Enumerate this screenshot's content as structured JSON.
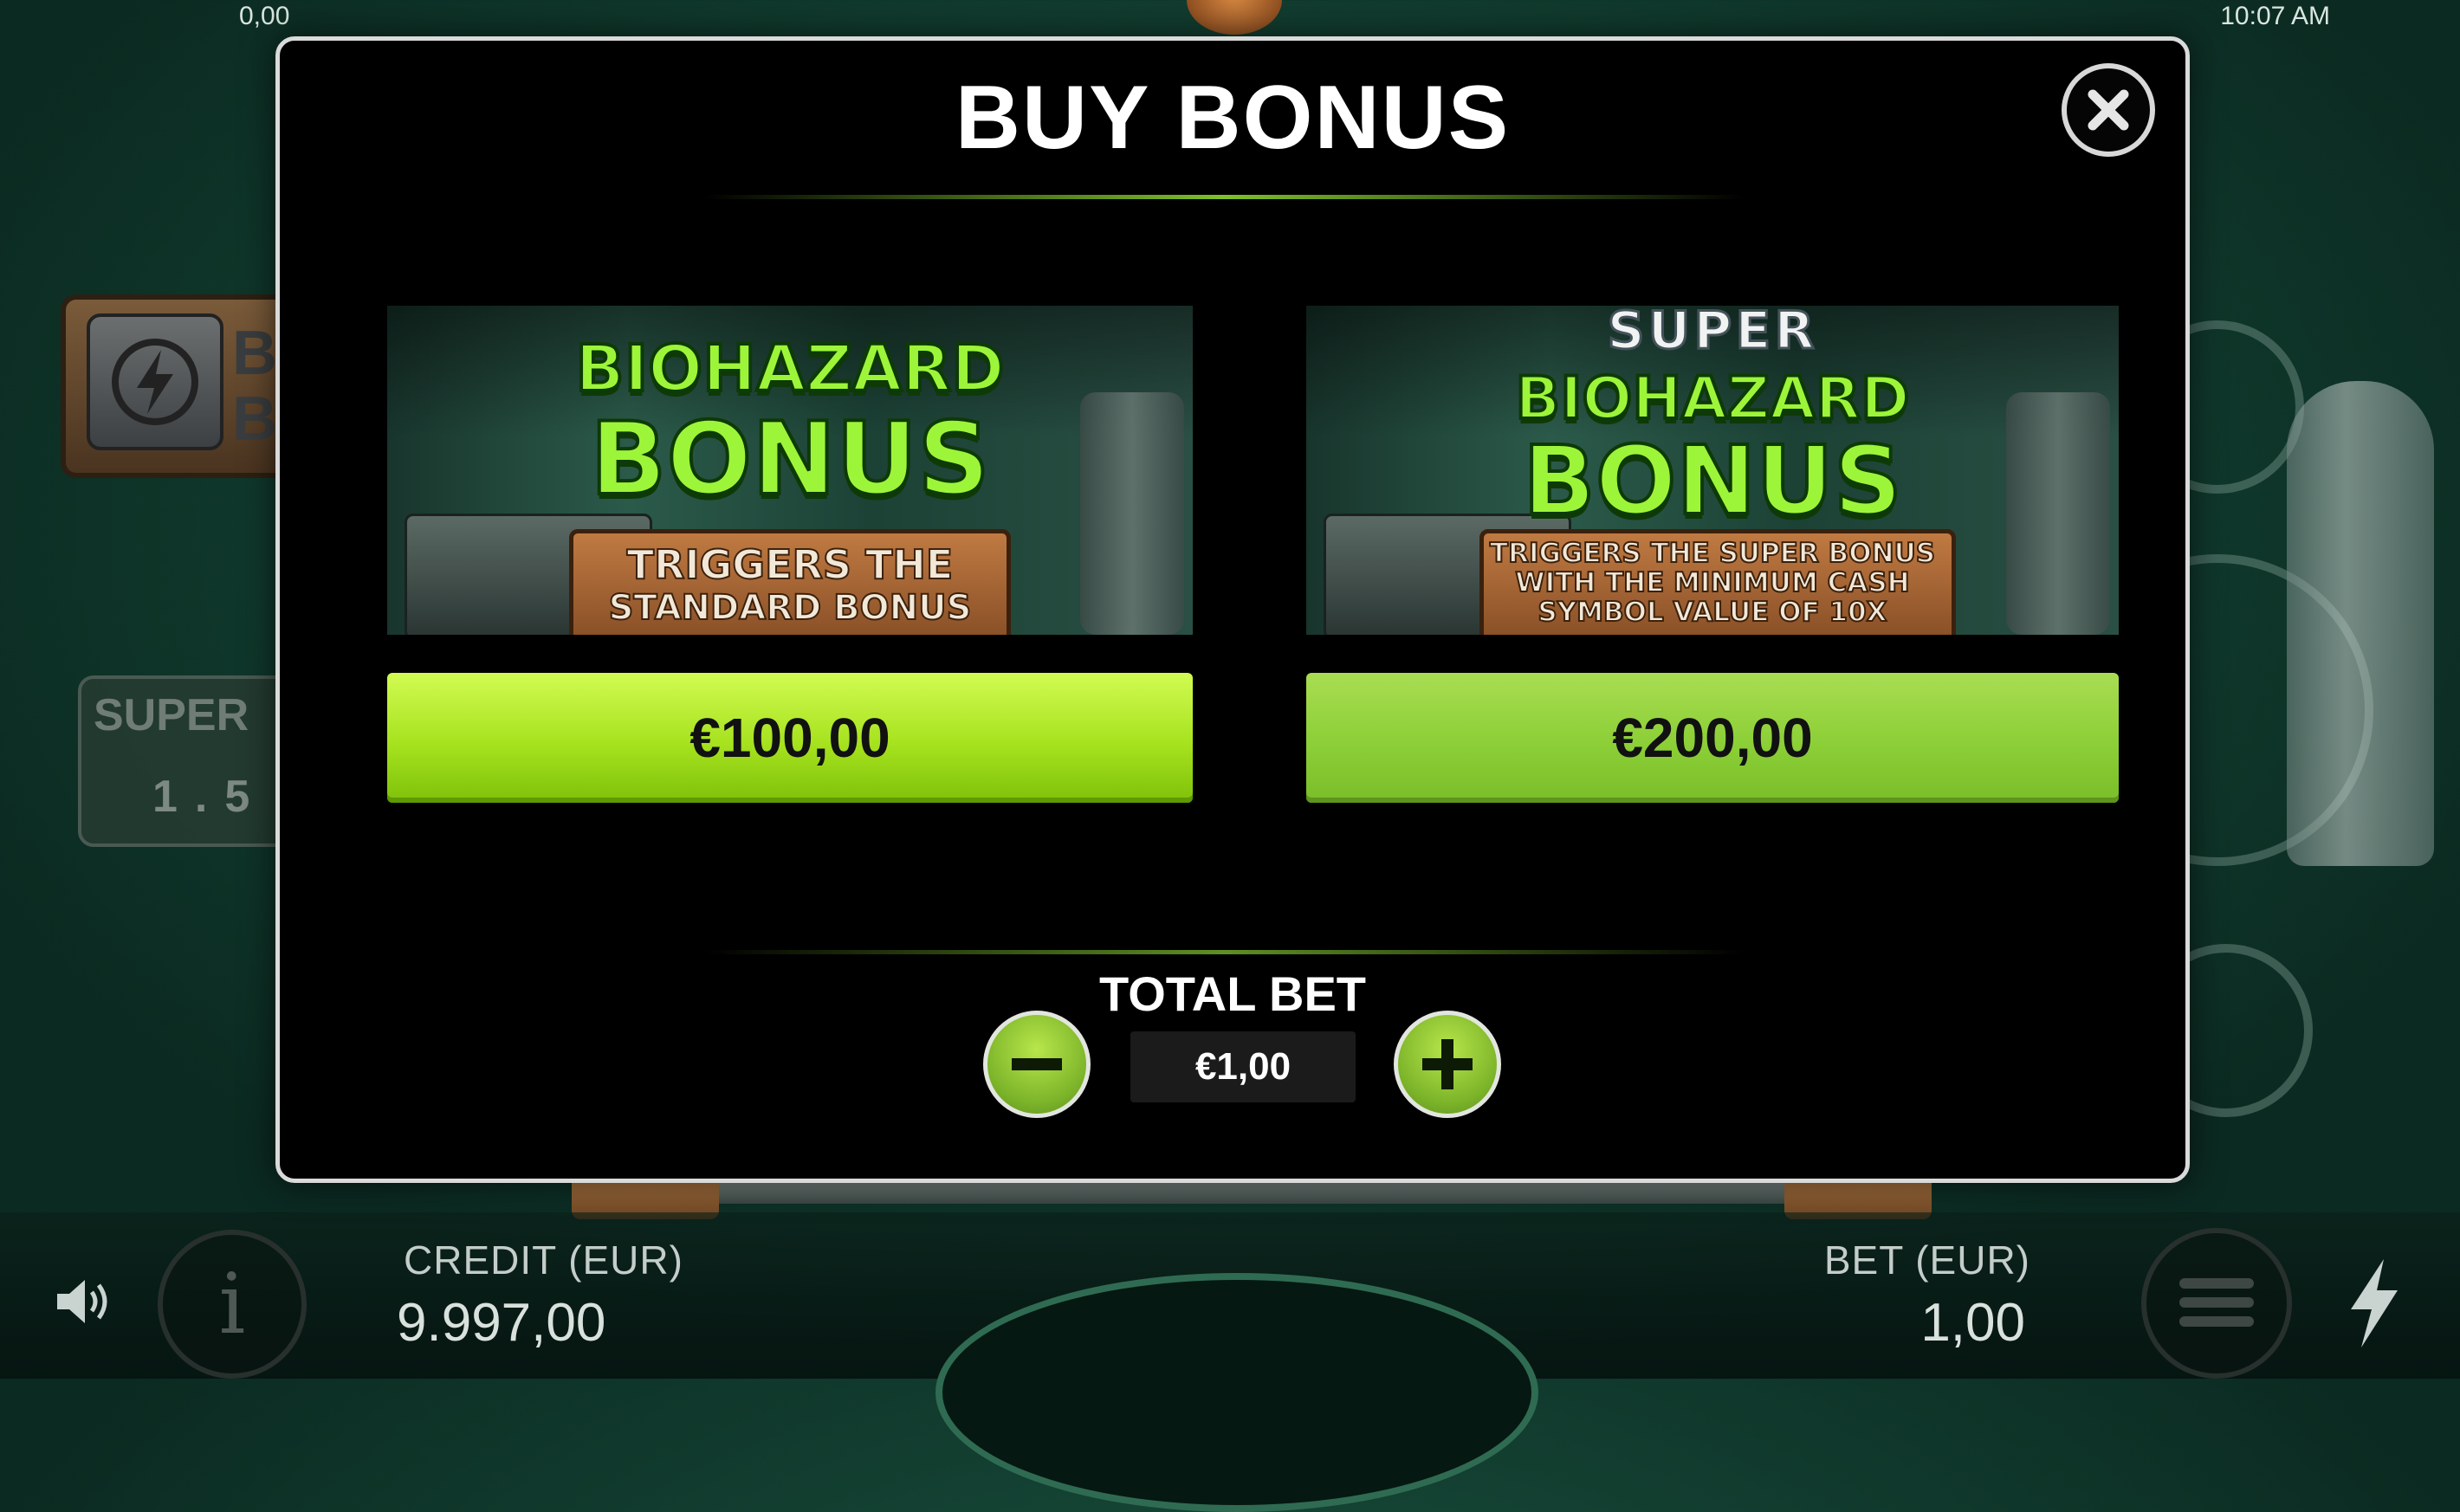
{
  "status_bar": {
    "left_value": "0,00",
    "time": "10:07 AM"
  },
  "modal": {
    "title": "BUY BONUS",
    "close_icon": "close-icon",
    "options": [
      {
        "art_super": "",
        "art_title_line1": "BIOHAZARD",
        "art_title_line2": "BONUS",
        "art_subtitle": [
          "TRIGGERS THE",
          "STANDARD BONUS"
        ],
        "price": "€100,00"
      },
      {
        "art_super": "SUPER",
        "art_title_line1": "BIOHAZARD",
        "art_title_line2": "BONUS",
        "art_subtitle": [
          "TRIGGERS THE SUPER BONUS",
          "WITH THE MINIMUM CASH",
          "SYMBOL VALUE OF 10X"
        ],
        "price": "€200,00"
      }
    ],
    "total_bet": {
      "label": "TOTAL BET",
      "value": "€1,00",
      "minus_icon": "minus-icon",
      "plus_icon": "plus-icon"
    }
  },
  "background": {
    "side_panel_text": [
      "BU",
      "BO"
    ],
    "super_panel_text": "SUPER",
    "super_panel_value": "1.5"
  },
  "hud": {
    "credit_label": "CREDIT (EUR)",
    "credit_value": "9.997,00",
    "bet_label": "BET (EUR)",
    "bet_value": "1,00",
    "icons": [
      "sound-icon",
      "info-icon",
      "menu-icon",
      "turbo-bolt-icon"
    ]
  },
  "colors": {
    "accent_green": "#9fe02a",
    "modal_bg": "#000000",
    "modal_border": "#d9dad9",
    "scene_green": "#1d5a44"
  }
}
